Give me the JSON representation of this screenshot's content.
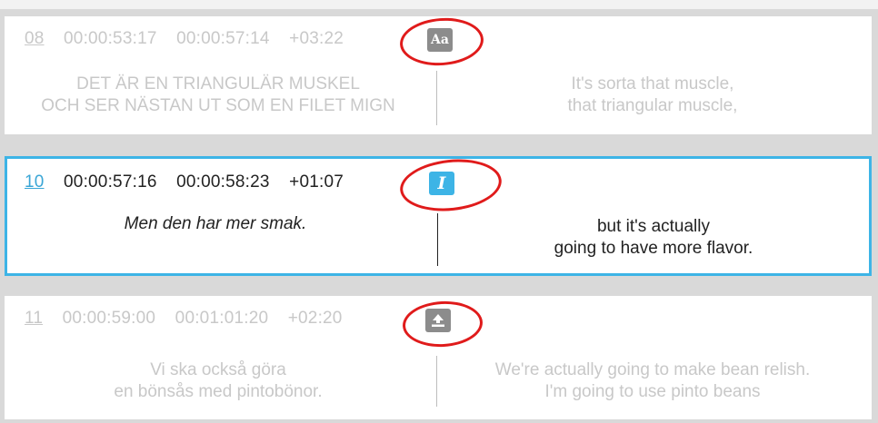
{
  "rows": [
    {
      "number": "08",
      "start": "00:00:53:17",
      "end": "00:00:57:14",
      "duration": "+03:22",
      "icon": "text-case-icon",
      "icon_label": "Aa",
      "source_lines": [
        "DET ÄR EN TRIANGULÄR MUSKEL",
        "OCH SER NÄSTAN UT SOM EN FILET MIGN"
      ],
      "target_lines": [
        "It's sorta that muscle,",
        "that triangular muscle,"
      ]
    },
    {
      "number": "10",
      "start": "00:00:57:16",
      "end": "00:00:58:23",
      "duration": "+01:07",
      "icon": "italic-icon",
      "icon_label": "I",
      "source_lines": [
        "Men den har mer smak."
      ],
      "target_lines": [
        "but it's actually",
        "going to have more flavor."
      ]
    },
    {
      "number": "11",
      "start": "00:00:59:00",
      "end": "00:01:01:20",
      "duration": "+02:20",
      "icon": "upload-icon",
      "source_lines": [
        "Vi ska också göra",
        "en bönsås med pintobönor."
      ],
      "target_lines": [
        "We're actually going to make bean relish.",
        "I'm going to use pinto beans"
      ]
    }
  ],
  "colors": {
    "selected_border": "#3db4e6",
    "annotation_circle": "#e01b1b",
    "inactive_text": "#c8c8c8"
  }
}
